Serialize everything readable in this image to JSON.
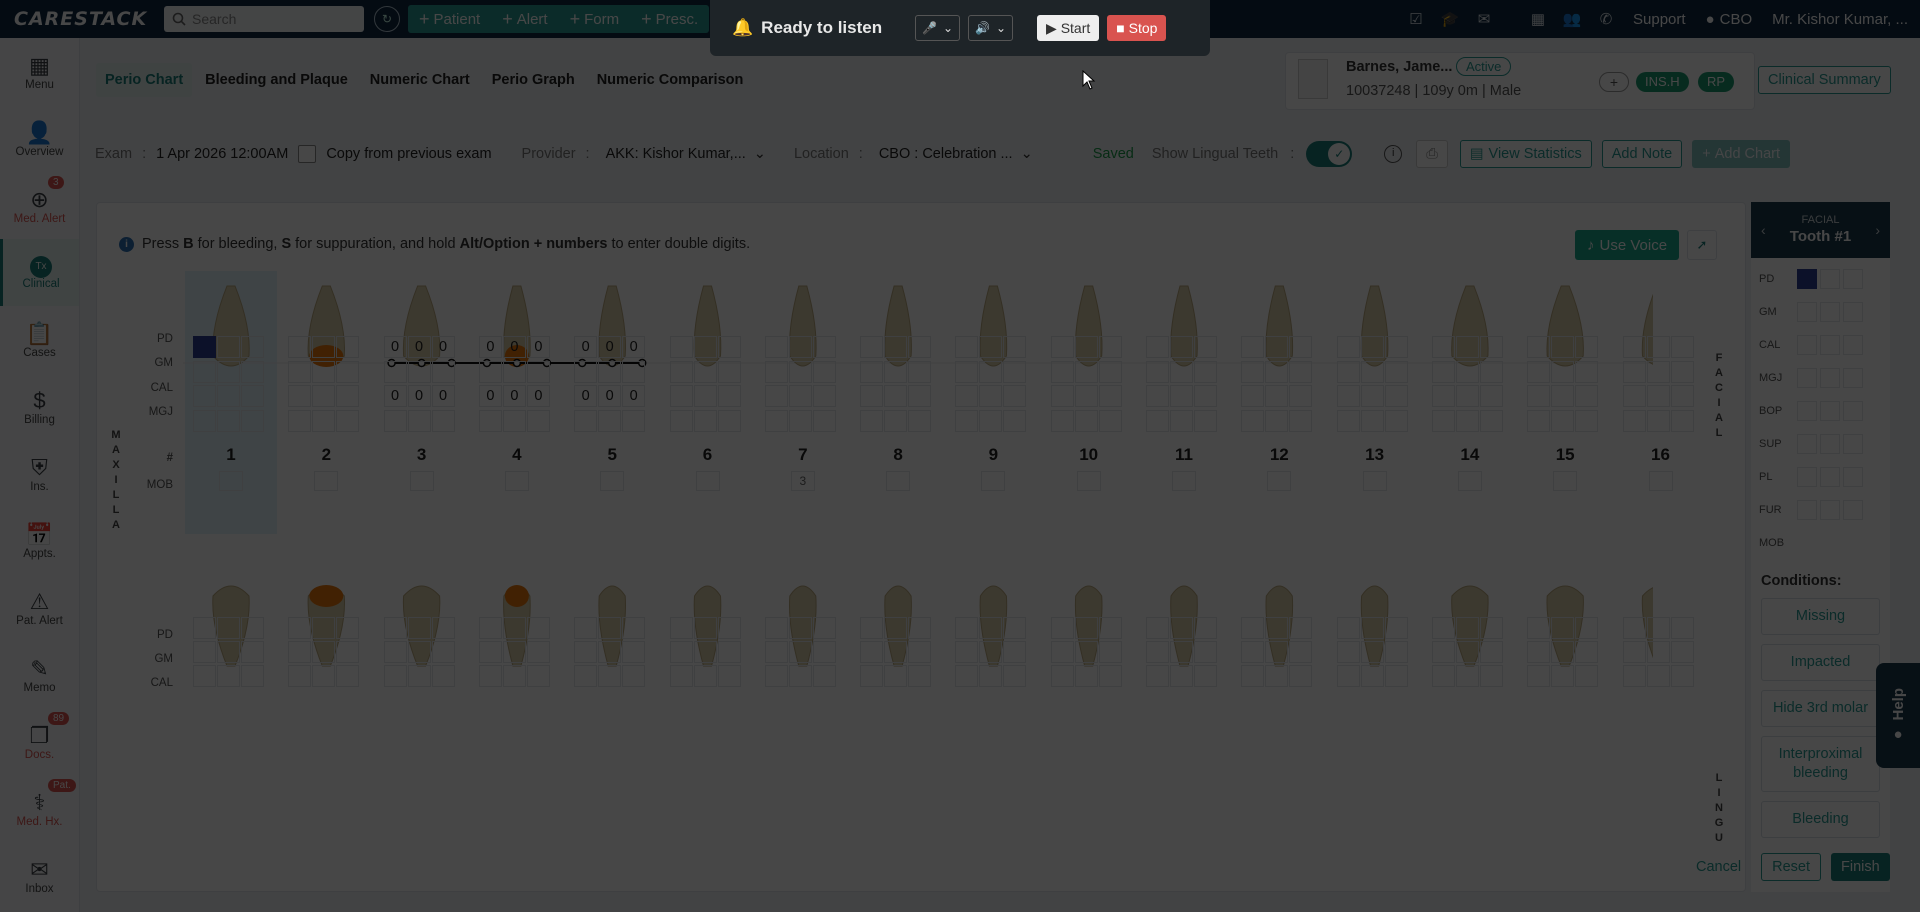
{
  "app": {
    "logo": "CARESTACK"
  },
  "topbar": {
    "search_placeholder": "Search",
    "actions": [
      "Patient",
      "Alert",
      "Form",
      "Presc."
    ],
    "support": "Support",
    "location": "CBO",
    "user": "Mr. Kishor Kumar, ..."
  },
  "voice": {
    "status": "Ready to listen",
    "start": "Start",
    "stop": "Stop"
  },
  "sidebar": {
    "items": [
      {
        "label": "Menu",
        "icon": "grid-icon"
      },
      {
        "label": "Overview",
        "icon": "person-icon"
      },
      {
        "label": "Med. Alert",
        "icon": "plus-circle-icon",
        "badge": "3"
      },
      {
        "label": "Clinical",
        "icon": "clinical-icon",
        "active": true
      },
      {
        "label": "Cases",
        "icon": "clipboard-icon"
      },
      {
        "label": "Billing",
        "icon": "billing-icon"
      },
      {
        "label": "Ins.",
        "icon": "shield-icon"
      },
      {
        "label": "Appts.",
        "icon": "calendar-icon"
      },
      {
        "label": "Pat. Alert",
        "icon": "warning-icon"
      },
      {
        "label": "Memo",
        "icon": "memo-icon"
      },
      {
        "label": "Docs.",
        "icon": "docs-icon",
        "badge": "89"
      },
      {
        "label": "Med. Hx.",
        "icon": "medhx-icon",
        "badge": "Pat."
      },
      {
        "label": "Inbox",
        "icon": "inbox-icon"
      }
    ]
  },
  "tabs": [
    "Perio Chart",
    "Bleeding and Plaque",
    "Numeric Chart",
    "Perio Graph",
    "Numeric Comparison"
  ],
  "patient": {
    "name": "Barnes, Jame...",
    "status": "Active",
    "info": "10037248 | 109y 0m | Male",
    "badges": [
      "INS.H",
      "RP"
    ],
    "plus": "+",
    "summary": "Clinical Summary"
  },
  "exam": {
    "exam_label": "Exam",
    "exam_value": "1 Apr 2026 12:00AM",
    "copy_label": "Copy from previous exam",
    "provider_label": "Provider",
    "provider_value": "AKK: Kishor Kumar,...",
    "location_label": "Location",
    "location_value": "CBO : Celebration ...",
    "saved": "Saved",
    "lingual_label": "Show Lingual Teeth",
    "view_stats": "View Statistics",
    "add_note": "Add Note",
    "add_chart": "Add Chart"
  },
  "chart": {
    "hint_parts": [
      "Press ",
      "B",
      " for bleeding, ",
      "S",
      " for suppuration, and hold ",
      "Alt/Option + numbers",
      " to enter double digits."
    ],
    "use_voice": "Use Voice",
    "row_labels_top": [
      "PD",
      "GM",
      "CAL",
      "MGJ"
    ],
    "num_label": "#",
    "mob_label": "MOB",
    "row_labels_bottom": [
      "PD",
      "GM",
      "CAL"
    ],
    "maxilla": [
      "M",
      "A",
      "X",
      "I",
      "L",
      "L",
      "A"
    ],
    "facial": [
      "F",
      "A",
      "C",
      "I",
      "A",
      "L"
    ],
    "lingual": [
      "L",
      "I",
      "N",
      "G",
      "U"
    ],
    "teeth": [
      {
        "num": "1",
        "pd": [
          "",
          "",
          ""
        ],
        "cal": [
          "",
          "",
          ""
        ],
        "mob": ""
      },
      {
        "num": "2",
        "pd": [
          "",
          "",
          ""
        ],
        "cal": [
          "",
          "",
          ""
        ],
        "mob": ""
      },
      {
        "num": "3",
        "pd": [
          "0",
          "0",
          "0"
        ],
        "cal": [
          "0",
          "0",
          "0"
        ],
        "mob": ""
      },
      {
        "num": "4",
        "pd": [
          "0",
          "0",
          "0"
        ],
        "cal": [
          "0",
          "0",
          "0"
        ],
        "mob": ""
      },
      {
        "num": "5",
        "pd": [
          "0",
          "0",
          "0"
        ],
        "cal": [
          "0",
          "0",
          "0"
        ],
        "mob": ""
      },
      {
        "num": "6",
        "pd": [
          "",
          "",
          ""
        ],
        "cal": [
          "",
          "",
          ""
        ],
        "mob": ""
      },
      {
        "num": "7",
        "pd": [
          "",
          "",
          ""
        ],
        "cal": [
          "",
          "",
          ""
        ],
        "mob": "3"
      },
      {
        "num": "8",
        "pd": [
          "",
          "",
          ""
        ],
        "cal": [
          "",
          "",
          ""
        ],
        "mob": ""
      },
      {
        "num": "9",
        "pd": [
          "",
          "",
          ""
        ],
        "cal": [
          "",
          "",
          ""
        ],
        "mob": ""
      },
      {
        "num": "10",
        "pd": [
          "",
          "",
          ""
        ],
        "cal": [
          "",
          "",
          ""
        ],
        "mob": ""
      },
      {
        "num": "11",
        "pd": [
          "",
          "",
          ""
        ],
        "cal": [
          "",
          "",
          ""
        ],
        "mob": ""
      },
      {
        "num": "12",
        "pd": [
          "",
          "",
          ""
        ],
        "cal": [
          "",
          "",
          ""
        ],
        "mob": ""
      },
      {
        "num": "13",
        "pd": [
          "",
          "",
          ""
        ],
        "cal": [
          "",
          "",
          ""
        ],
        "mob": ""
      },
      {
        "num": "14",
        "pd": [
          "",
          "",
          ""
        ],
        "cal": [
          "",
          "",
          ""
        ],
        "mob": ""
      },
      {
        "num": "15",
        "pd": [
          "",
          "",
          ""
        ],
        "cal": [
          "",
          "",
          ""
        ],
        "mob": ""
      },
      {
        "num": "16",
        "pd": [
          "",
          "",
          ""
        ],
        "cal": [
          "",
          "",
          ""
        ],
        "mob": ""
      }
    ]
  },
  "tooth_panel": {
    "side": "FACIAL",
    "tooth": "Tooth #1",
    "rows": [
      "PD",
      "GM",
      "CAL",
      "MGJ",
      "BOP",
      "SUP",
      "PL",
      "FUR",
      "MOB"
    ],
    "conditions_label": "Conditions:",
    "conditions": [
      "Missing",
      "Impacted",
      "Hide 3rd molar",
      "Interproximal bleeding",
      "Bleeding"
    ]
  },
  "footer": {
    "cancel": "Cancel",
    "reset": "Reset",
    "finish": "Finish"
  },
  "help": "Help",
  "colors": {
    "teal": "#2a9c95",
    "navy": "#102a43",
    "selected_cell": "#2c3f95",
    "highlight_tooth": "#e8780c"
  }
}
